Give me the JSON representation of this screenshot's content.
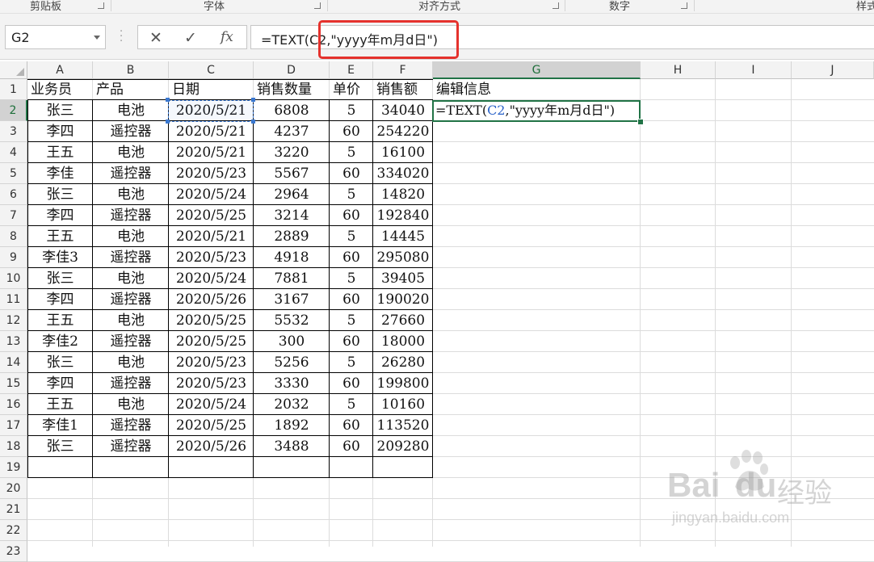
{
  "ribbon": {
    "groups": [
      "剪贴板",
      "字体",
      "对齐方式",
      "数字",
      "样式"
    ]
  },
  "formula_bar": {
    "name_box": "G2",
    "cancel_icon": "✕",
    "enter_icon": "✓",
    "fx_label": "fx",
    "formula": "=TEXT(C2,\"yyyy年m月d日\")"
  },
  "columns": [
    "A",
    "B",
    "C",
    "D",
    "E",
    "F",
    "G",
    "H",
    "I",
    "J"
  ],
  "rows": [
    "1",
    "2",
    "3",
    "4",
    "5",
    "6",
    "7",
    "8",
    "9",
    "10",
    "11",
    "12",
    "13",
    "14",
    "15",
    "16",
    "17",
    "18",
    "19",
    "20",
    "21",
    "22",
    "23"
  ],
  "headers": [
    "业务员",
    "产品",
    "日期",
    "销售数量",
    "单价",
    "销售额",
    "编辑信息"
  ],
  "table": [
    [
      "张三",
      "电池",
      "2020/5/21",
      "6808",
      "5",
      "34040"
    ],
    [
      "李四",
      "遥控器",
      "2020/5/21",
      "4237",
      "60",
      "254220"
    ],
    [
      "王五",
      "电池",
      "2020/5/21",
      "3220",
      "5",
      "16100"
    ],
    [
      "李佳",
      "遥控器",
      "2020/5/23",
      "5567",
      "60",
      "334020"
    ],
    [
      "张三",
      "电池",
      "2020/5/24",
      "2964",
      "5",
      "14820"
    ],
    [
      "李四",
      "遥控器",
      "2020/5/25",
      "3214",
      "60",
      "192840"
    ],
    [
      "王五",
      "电池",
      "2020/5/21",
      "2889",
      "5",
      "14445"
    ],
    [
      "李佳3",
      "遥控器",
      "2020/5/23",
      "4918",
      "60",
      "295080"
    ],
    [
      "张三",
      "电池",
      "2020/5/24",
      "7881",
      "5",
      "39405"
    ],
    [
      "李四",
      "遥控器",
      "2020/5/26",
      "3167",
      "60",
      "190020"
    ],
    [
      "王五",
      "电池",
      "2020/5/25",
      "5532",
      "5",
      "27660"
    ],
    [
      "李佳2",
      "遥控器",
      "2020/5/25",
      "300",
      "60",
      "18000"
    ],
    [
      "张三",
      "电池",
      "2020/5/23",
      "5256",
      "5",
      "26280"
    ],
    [
      "李四",
      "遥控器",
      "2020/5/23",
      "3330",
      "60",
      "199800"
    ],
    [
      "王五",
      "电池",
      "2020/5/24",
      "2032",
      "5",
      "10160"
    ],
    [
      "李佳1",
      "遥控器",
      "2020/5/25",
      "1892",
      "60",
      "113520"
    ],
    [
      "张三",
      "遥控器",
      "2020/5/26",
      "3488",
      "60",
      "209280"
    ]
  ],
  "g2_edit": {
    "prefix": "=TEXT(",
    "ref": "C2",
    "suffix": ",\"yyyy年m月d日\")"
  },
  "watermark": {
    "brand": "Bai",
    "brand2": "du",
    "cn": "经验",
    "url": "jingyan.baidu.com"
  },
  "colors": {
    "accent_green": "#217346",
    "highlight_red": "#e5322d",
    "ref_blue": "#2a63c9"
  }
}
